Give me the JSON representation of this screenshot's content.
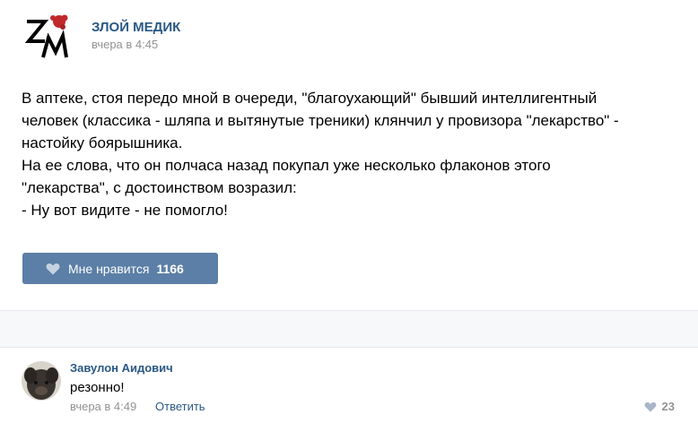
{
  "post": {
    "author": "ЗЛОЙ МЕДИК",
    "time": "вчера в 4:45",
    "text_lines": [
      "В аптеке, стоя передо мной в очереди, \"благоухающий\" бывший интеллигентный",
      "человек (классика - шляпа и вытянутые треники) клянчил у провизора \"лекарство\" -",
      "настойку боярышника.",
      "На ее слова, что он полчаса назад покупал уже несколько флаконов этого",
      "\"лекарства\", с достоинством возразил:",
      "- Ну вот видите - не помогло!"
    ],
    "like_label": "Мне нравится",
    "like_count": "1166"
  },
  "comment": {
    "author": "Завулон Аидович",
    "text": "резонно!",
    "time": "вчера в 4:49",
    "reply_label": "Ответить",
    "like_count": "23"
  },
  "colors": {
    "link": "#2a5885",
    "like_button": "#5b7fa6",
    "muted": "#939393",
    "divider_bg": "#f7f8fa"
  },
  "icons": {
    "post_avatar": "logo-icon",
    "like": "heart-icon",
    "comment_like": "heart-icon",
    "comment_avatar": "avatar"
  }
}
